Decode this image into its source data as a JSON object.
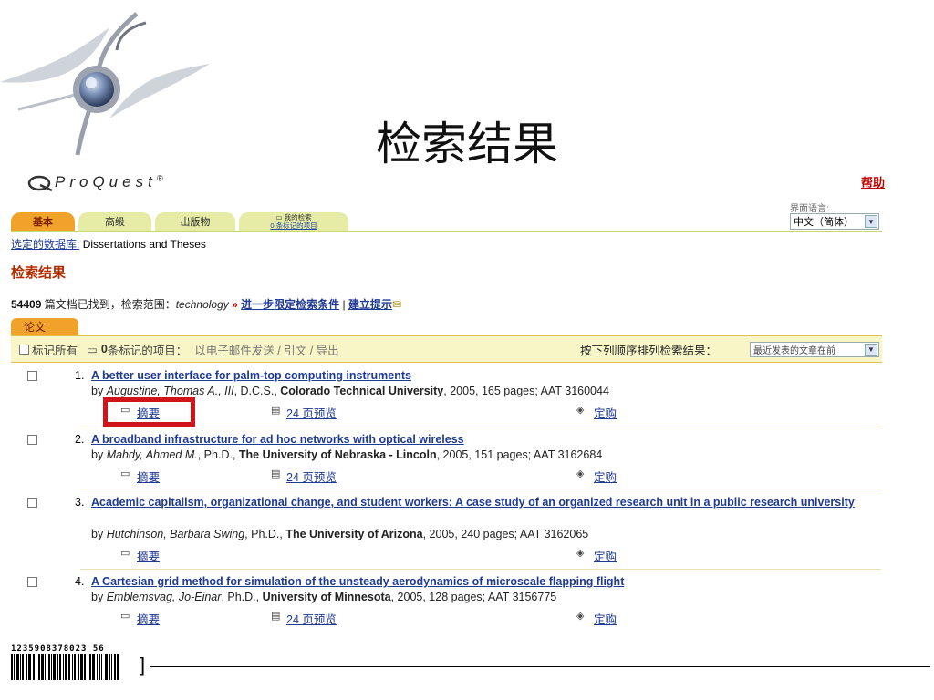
{
  "slide": {
    "title": "检索结果"
  },
  "header": {
    "brand": "ProQuest",
    "brand_mark": "®",
    "help": "帮助",
    "language_label": "界面语言:",
    "language_value": "中文（简体）"
  },
  "tabs": [
    {
      "label": "基本",
      "active": true
    },
    {
      "label": "高级"
    },
    {
      "label": "出版物"
    },
    {
      "label": "我的检索",
      "sub": "0 条标记的项目"
    }
  ],
  "database": {
    "label": "选定的数据库:",
    "value": "Dissertations and Theses"
  },
  "section_title": "检索结果",
  "summary": {
    "count": "54409",
    "text": " 篇文档已找到，检索范围：",
    "term": "technology",
    "refine": "进一步限定检索条件",
    "divider": " | ",
    "alert": "建立提示"
  },
  "paper_tab": "论文",
  "toolbar": {
    "mark_all": "标记所有",
    "marked_count": "0",
    "marked_text": " 条标记的项目：",
    "actions": "以电子邮件发送 / 引文 / 导出",
    "sort_label": "按下列顺序排列检索结果：",
    "sort_value": "最近发表的文章在前"
  },
  "results": [
    {
      "num": "1.",
      "title": "A better user interface for palm-top computing instruments",
      "author": "Augustine, Thomas A., III",
      "degree": ", D.C.S., ",
      "school": "Colorado Technical University",
      "details": ", 2005, 165 pages; AAT 3160044",
      "abstract": "摘要",
      "preview": "24 页预览",
      "order": "定购"
    },
    {
      "num": "2.",
      "title": "A broadband infrastructure for ad hoc networks with optical wireless",
      "author": "Mahdy, Ahmed M.",
      "degree": ", Ph.D., ",
      "school": "The University of Nebraska - Lincoln",
      "details": ", 2005, 151 pages; AAT 3162684",
      "abstract": "摘要",
      "preview": "24 页预览",
      "order": "定购"
    },
    {
      "num": "3.",
      "title": "Academic capitalism, organizational change, and student workers: A case study of an organized research unit in a public research university",
      "author": "Hutchinson, Barbara Swing",
      "degree": ", Ph.D., ",
      "school": "The University of Arizona",
      "details": ", 2005, 240 pages; AAT 3162065",
      "abstract": "摘要",
      "order": "定购"
    },
    {
      "num": "4.",
      "title": "A Cartesian grid method for simulation of the unsteady aerodynamics of microscale flapping flight",
      "author": "Emblemsvag, Jo-Einar",
      "degree": ", Ph.D., ",
      "school": "University of Minnesota",
      "details": ", 2005, 128 pages; AAT 3156775",
      "abstract": "摘要",
      "preview": "24 页预览",
      "order": "定购"
    }
  ],
  "footer": {
    "barcode_number": "1235908378023 56"
  },
  "colors": {
    "accent": "#f0a22a",
    "link": "#1f3a93",
    "section": "#b22c00",
    "highlight": "#d0151a"
  }
}
